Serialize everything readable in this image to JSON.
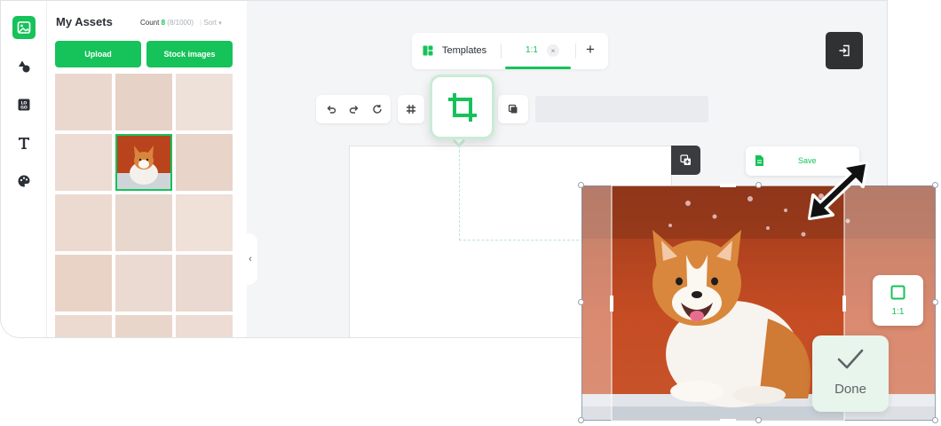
{
  "sidebar": {
    "title": "My Assets",
    "count_label": "Count",
    "count_value": "8",
    "count_limit": "(8/1000)",
    "sort_label": "Sort",
    "upload_label": "Upload",
    "stock_label": "Stock images"
  },
  "topbar": {
    "templates_label": "Templates",
    "ratio_label": "1:1",
    "close_glyph": "×",
    "add_glyph": "+"
  },
  "canvas": {
    "save_label": "Save"
  },
  "crop": {
    "ratio_card_label": "1:1",
    "done_label": "Done"
  },
  "icons": {
    "rail": [
      "image-icon",
      "shapes-icon",
      "logo-icon",
      "text-icon",
      "palette-icon"
    ],
    "toolbar": [
      "undo-icon",
      "redo-icon",
      "refresh-icon",
      "grid-icon",
      "crop-icon",
      "layers-icon"
    ]
  },
  "colors": {
    "accent": "#16c25a",
    "dark": "#2f3133",
    "background": "#f4f5f7",
    "tile": "#e8d7cd"
  }
}
